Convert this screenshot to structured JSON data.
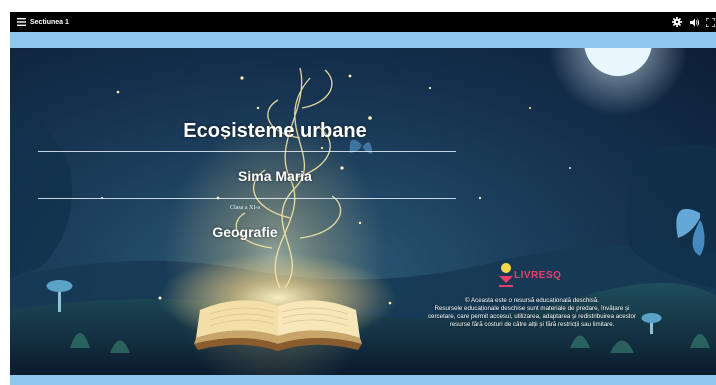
{
  "topbar": {
    "title": "Sectiunea 1",
    "icons": [
      "menu-icon",
      "gear-icon",
      "speaker-icon",
      "fullscreen-icon"
    ]
  },
  "slide": {
    "title": "Ecosisteme urbane",
    "author": "Sima Maria",
    "grade": "Clasa a XI-a",
    "subject": "Geografie",
    "logo": "LIVRESQ",
    "license_lines": [
      "© Aceasta este o resursă educațională deschisă.",
      "Resursele educaționale deschise sunt materiale de predare, învățare și",
      "cercetare, care permit accesul, utilizarea, adaptarea și redistribuirea acestor",
      "resurse fără costuri de către alții și fără restricții sau limitare."
    ]
  },
  "colors": {
    "topbar": "#000000",
    "band": "#8cc8ee",
    "logo": "#e83e6b",
    "logo_dot": "#f5d84a",
    "background": "#1d4260"
  }
}
